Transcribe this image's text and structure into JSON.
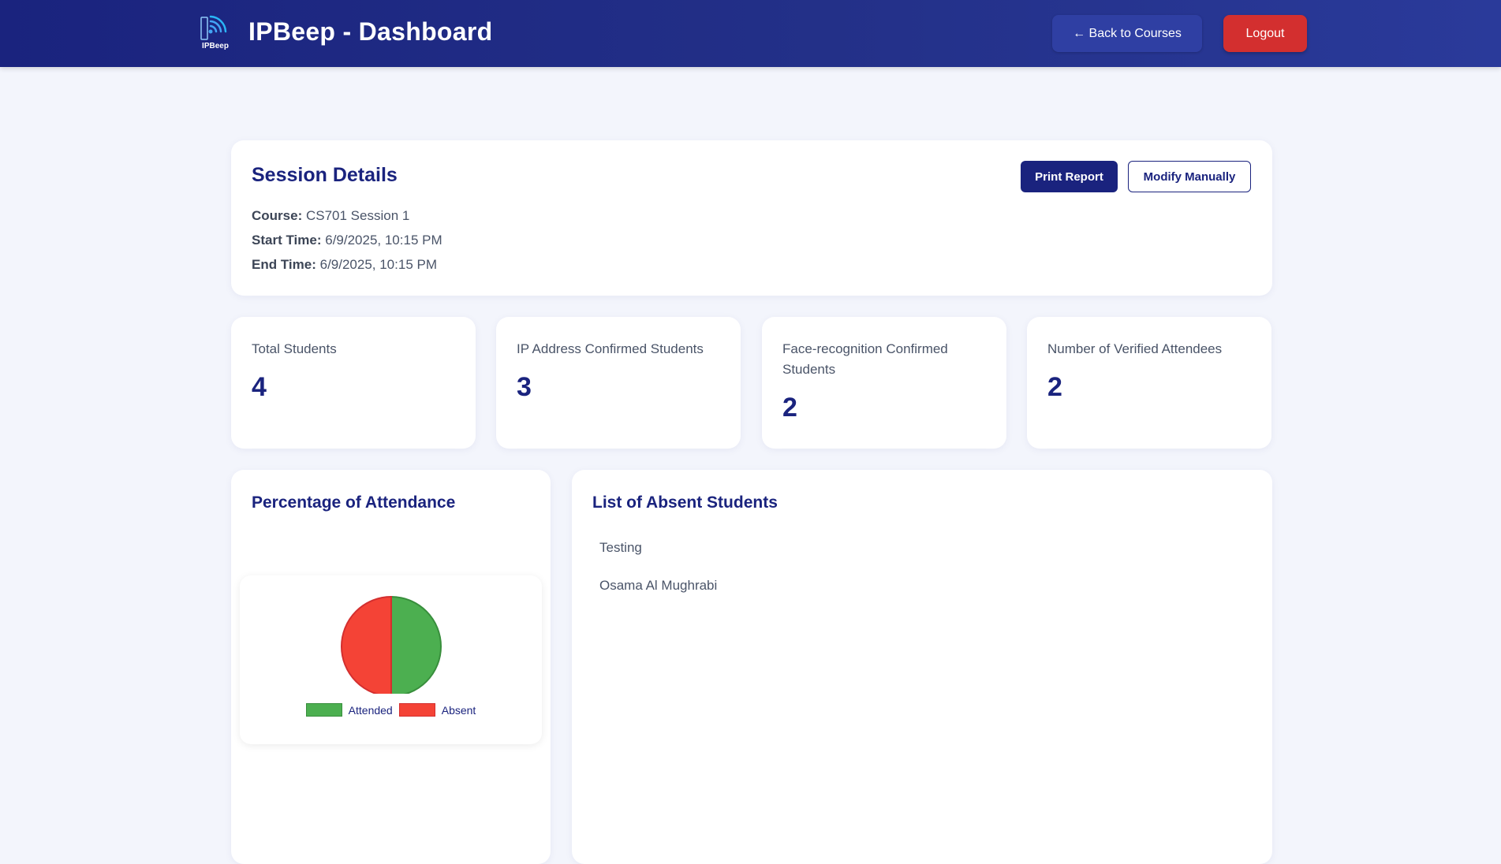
{
  "header": {
    "logo_text": "IPBeep",
    "title": "IPBeep - Dashboard",
    "back_label": "← Back to Courses",
    "logout_label": "Logout"
  },
  "session": {
    "title": "Session Details",
    "print_label": "Print Report",
    "modify_label": "Modify Manually",
    "course_label": "Course:",
    "course_value": "CS701 Session 1",
    "start_label": "Start Time:",
    "start_value": "6/9/2025, 10:15 PM",
    "end_label": "End Time:",
    "end_value": "6/9/2025, 10:15 PM"
  },
  "stats": [
    {
      "label": "Total Students",
      "value": "4"
    },
    {
      "label": "IP Address Confirmed Students",
      "value": "3"
    },
    {
      "label": "Face-recognition Confirmed Students",
      "value": "2"
    },
    {
      "label": "Number of Verified Attendees",
      "value": "2"
    }
  ],
  "attendance": {
    "title": "Percentage of Attendance"
  },
  "chart_data": {
    "type": "pie",
    "categories": [
      "Attended",
      "Absent"
    ],
    "values": [
      50,
      50
    ],
    "colors": [
      "#4caf50",
      "#f44336"
    ],
    "border_colors": [
      "#388e3c",
      "#d32f2f"
    ],
    "legend": "bottom"
  },
  "absent": {
    "title": "List of Absent Students",
    "students": [
      "Testing",
      "Osama Al Mughrabi"
    ]
  }
}
